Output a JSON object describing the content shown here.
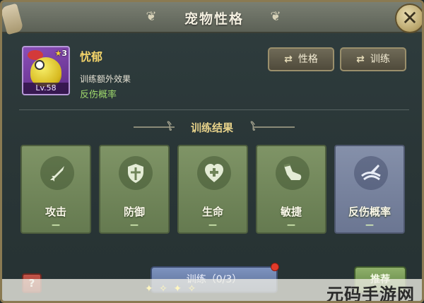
{
  "window": {
    "title": "宠物性格",
    "close_label": "✕"
  },
  "pet": {
    "name": "忧郁",
    "stars": "3",
    "level": "Lv.58",
    "extra_effect_label": "训练额外效果",
    "extra_effect_value": "反伤概率"
  },
  "actions": {
    "personality_label": "性格",
    "train_label": "训练"
  },
  "results": {
    "heading": "训练结果",
    "stats": [
      {
        "label": "攻击",
        "value": "—",
        "icon": "sword-icon"
      },
      {
        "label": "防御",
        "value": "—",
        "icon": "shield-icon"
      },
      {
        "label": "生命",
        "value": "—",
        "icon": "heart-plus-icon"
      },
      {
        "label": "敏捷",
        "value": "—",
        "icon": "boot-icon"
      },
      {
        "label": "反伤概率",
        "value": "—",
        "icon": "reflect-icon"
      }
    ],
    "selected_index": 4
  },
  "footer": {
    "help_label": "?",
    "train_button_label": "训练（0/3）",
    "recommend_label": "推荐",
    "watermark": "元码手游网"
  },
  "colors": {
    "card_green": "#7f9466",
    "card_selected": "#8590aa",
    "name_gold": "#f3d46a",
    "effect_green": "#9fd86c"
  }
}
